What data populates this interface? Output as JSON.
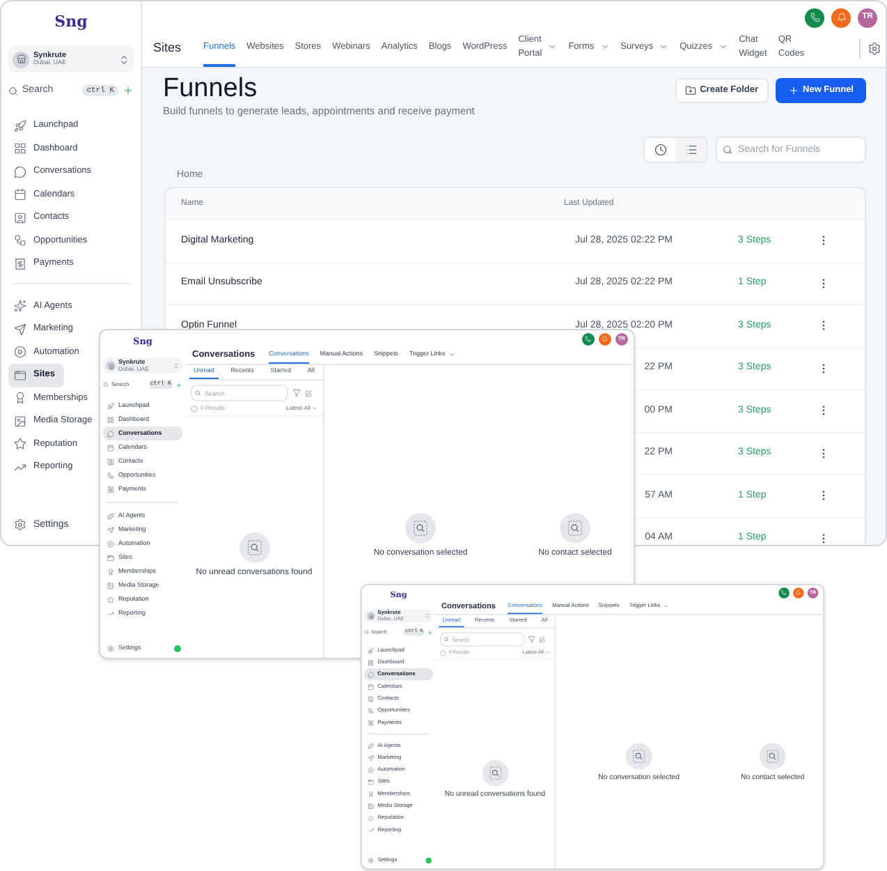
{
  "funnels_window": {
    "logo": "Sng",
    "account": {
      "name": "Synkrute",
      "location": "Dubai, UAE"
    },
    "search": {
      "placeholder": "Search",
      "shortcut": "ctrl K"
    },
    "sidebar": {
      "groups": [
        [
          {
            "label": "Launchpad",
            "selected": false
          },
          {
            "label": "Dashboard",
            "selected": false
          },
          {
            "label": "Conversations",
            "selected": false
          },
          {
            "label": "Calendars",
            "selected": false
          },
          {
            "label": "Contacts",
            "selected": false
          },
          {
            "label": "Opportunities",
            "selected": false
          },
          {
            "label": "Payments",
            "selected": false
          }
        ],
        [
          {
            "label": "AI Agents",
            "selected": false
          },
          {
            "label": "Marketing",
            "selected": false
          },
          {
            "label": "Automation",
            "selected": false
          },
          {
            "label": "Sites",
            "selected": true
          },
          {
            "label": "Memberships",
            "selected": false
          },
          {
            "label": "Media Storage",
            "selected": false
          },
          {
            "label": "Reputation",
            "selected": false
          },
          {
            "label": "Reporting",
            "selected": false
          }
        ]
      ],
      "settings": "Settings"
    },
    "header": {
      "section": "Sites",
      "tabs": [
        {
          "label": "Funnels",
          "selected": true,
          "dropdown": false
        },
        {
          "label": "Websites",
          "selected": false,
          "dropdown": false
        },
        {
          "label": "Stores",
          "selected": false,
          "dropdown": false
        },
        {
          "label": "Webinars",
          "selected": false,
          "dropdown": false
        },
        {
          "label": "Analytics",
          "selected": false,
          "dropdown": false
        },
        {
          "label": "Blogs",
          "selected": false,
          "dropdown": false
        },
        {
          "label": "WordPress",
          "selected": false,
          "dropdown": false
        },
        {
          "label": "Client Portal",
          "selected": false,
          "dropdown": true
        },
        {
          "label": "Forms",
          "selected": false,
          "dropdown": true
        },
        {
          "label": "Surveys",
          "selected": false,
          "dropdown": true
        },
        {
          "label": "Quizzes",
          "selected": false,
          "dropdown": true
        },
        {
          "label": "Chat Widget",
          "selected": false,
          "dropdown": false
        },
        {
          "label": "QR Codes",
          "selected": false,
          "dropdown": false
        }
      ],
      "avatar": "TR"
    },
    "page": {
      "title": "Funnels",
      "subtitle": "Build funnels to generate leads, appointments and receive payment",
      "buttons": [
        {
          "label": "Create Folder",
          "kind": "secondary"
        },
        {
          "label": "New Funnel",
          "kind": "primary"
        }
      ],
      "views": [
        {
          "kind": "recent",
          "selected": false
        },
        {
          "kind": "list",
          "selected": true
        }
      ],
      "search": {
        "placeholder": "Search for Funnels"
      },
      "breadcrumb": "Home",
      "table": {
        "columns": [
          "Name",
          "Last Updated"
        ],
        "rows": [
          {
            "name": "Digital Marketing",
            "updated": "Jul 28, 2025 02:22 PM",
            "steps": "3 Steps"
          },
          {
            "name": "Email Unsubscribe",
            "updated": "Jul 28, 2025 02:22 PM",
            "steps": "1 Step"
          },
          {
            "name": "Optin Funnel",
            "updated": "Jul 28, 2025 02:20 PM",
            "steps": "3 Steps"
          },
          {
            "updated": "22 PM",
            "steps": "3 Steps"
          },
          {
            "updated": "00 PM",
            "steps": "3 Steps"
          },
          {
            "updated": "22 PM",
            "steps": "3 Steps"
          },
          {
            "updated": "57 AM",
            "steps": "1 Step"
          },
          {
            "updated": "04 AM",
            "steps": "1 Step"
          }
        ]
      }
    }
  },
  "conversation_windows": [
    {
      "logo": "Sng",
      "account": {
        "name": "Synkrute",
        "location": "Dubai, UAE"
      },
      "search": {
        "placeholder": "Search",
        "shortcut": "ctrl K"
      },
      "sidebar": {
        "groups": [
          [
            {
              "label": "Launchpad",
              "selected": false
            },
            {
              "label": "Dashboard",
              "selected": false
            },
            {
              "label": "Conversations",
              "selected": true
            },
            {
              "label": "Calendars",
              "selected": false
            },
            {
              "label": "Contacts",
              "selected": false
            },
            {
              "label": "Opportunities",
              "selected": false
            },
            {
              "label": "Payments",
              "selected": false
            }
          ],
          [
            {
              "label": "AI Agents",
              "selected": false
            },
            {
              "label": "Marketing",
              "selected": false
            },
            {
              "label": "Automation",
              "selected": false
            },
            {
              "label": "Sites",
              "selected": false
            },
            {
              "label": "Memberships",
              "selected": false
            },
            {
              "label": "Media Storage",
              "selected": false
            },
            {
              "label": "Reputation",
              "selected": false
            },
            {
              "label": "Reporting",
              "selected": false
            }
          ]
        ],
        "settings": "Settings"
      },
      "online": true,
      "header": {
        "title": "Conversations",
        "tabs": [
          {
            "label": "Conversations",
            "selected": true,
            "dropdown": false
          },
          {
            "label": "Manual Actions",
            "selected": false,
            "dropdown": false
          },
          {
            "label": "Snippets",
            "selected": false,
            "dropdown": false
          },
          {
            "label": "Trigger Links",
            "selected": false,
            "dropdown": true
          }
        ],
        "avatar": "TR"
      },
      "list": {
        "tabs": [
          {
            "label": "Unread",
            "selected": true
          },
          {
            "label": "Recents",
            "selected": false
          },
          {
            "label": "Starred",
            "selected": false
          },
          {
            "label": "All",
            "selected": false
          }
        ],
        "search": {
          "placeholder": "Search"
        },
        "select_all": {
          "checked": false
        },
        "results": "0 Results",
        "sort": "Latest-All",
        "empty": "No unread conversations found"
      },
      "panels": [
        "No conversation selected",
        "No contact selected"
      ]
    },
    {
      "logo": "Sng",
      "account": {
        "name": "Synkrute",
        "location": "Dubai, UAE"
      },
      "search": {
        "placeholder": "Search",
        "shortcut": "ctrl K"
      },
      "sidebar": {
        "groups": [
          [
            {
              "label": "Launchpad",
              "selected": false
            },
            {
              "label": "Dashboard",
              "selected": false
            },
            {
              "label": "Conversations",
              "selected": true
            },
            {
              "label": "Calendars",
              "selected": false
            },
            {
              "label": "Contacts",
              "selected": false
            },
            {
              "label": "Opportunities",
              "selected": false
            },
            {
              "label": "Payments",
              "selected": false
            }
          ],
          [
            {
              "label": "AI Agents",
              "selected": false
            },
            {
              "label": "Marketing",
              "selected": false
            },
            {
              "label": "Automation",
              "selected": false
            },
            {
              "label": "Sites",
              "selected": false
            },
            {
              "label": "Memberships",
              "selected": false
            },
            {
              "label": "Media Storage",
              "selected": false
            },
            {
              "label": "Reputation",
              "selected": false
            },
            {
              "label": "Reporting",
              "selected": false
            }
          ]
        ],
        "settings": "Settings"
      },
      "online": true,
      "header": {
        "title": "Conversations",
        "tabs": [
          {
            "label": "Conversations",
            "selected": true,
            "dropdown": false
          },
          {
            "label": "Manual Actions",
            "selected": false,
            "dropdown": false
          },
          {
            "label": "Snippets",
            "selected": false,
            "dropdown": false
          },
          {
            "label": "Trigger Links",
            "selected": false,
            "dropdown": true
          }
        ],
        "avatar": "TR"
      },
      "list": {
        "tabs": [
          {
            "label": "Unread",
            "selected": true
          },
          {
            "label": "Recents",
            "selected": false
          },
          {
            "label": "Starred",
            "selected": false
          },
          {
            "label": "All",
            "selected": false
          }
        ],
        "search": {
          "placeholder": "Search"
        },
        "select_all": {
          "checked": false
        },
        "results": "0 Results",
        "sort": "Latest-All",
        "empty": "No unread conversations found"
      },
      "panels": [
        "No conversation selected",
        "No contact selected"
      ]
    }
  ]
}
